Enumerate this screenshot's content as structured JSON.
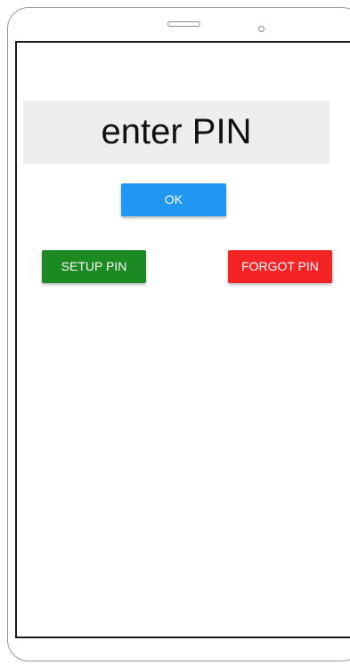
{
  "screen": {
    "pin_prompt": "enter PIN"
  },
  "buttons": {
    "ok_label": "OK",
    "setup_label": "SETUP PIN",
    "forgot_label": "FORGOT PIN"
  },
  "colors": {
    "ok": "#2196f3",
    "setup": "#1b8a23",
    "forgot": "#f52424",
    "pin_display_bg": "#eeeeee"
  }
}
